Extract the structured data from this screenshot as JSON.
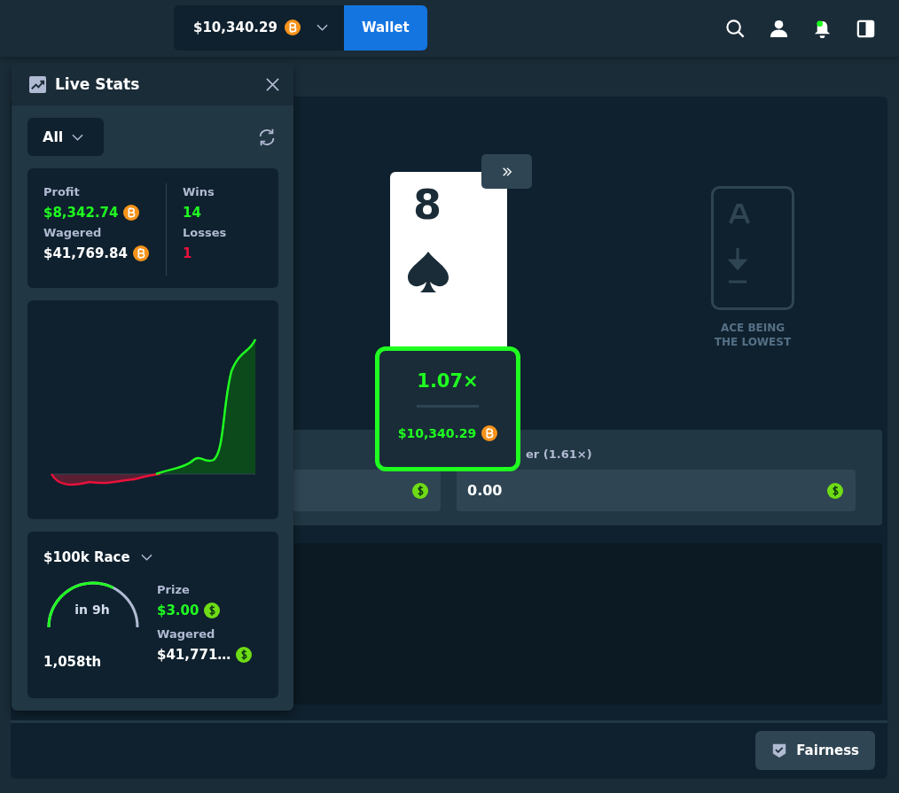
{
  "wallet": {
    "balance": "$10,340.29",
    "button": "Wallet"
  },
  "notifications": {
    "unread": true
  },
  "live_stats": {
    "title": "Live Stats",
    "filter": "All",
    "profit_label": "Profit",
    "profit": "$8,342.74",
    "wagered_label": "Wagered",
    "wagered": "$41,769.84",
    "wins_label": "Wins",
    "wins": "14",
    "losses_label": "Losses",
    "losses": "1"
  },
  "race": {
    "title": "$100k Race",
    "time": "in 9h",
    "level": 0.65,
    "rank": "1,058th",
    "prize_label": "Prize",
    "prize": "$3.00",
    "wagered_label": "Wagered",
    "wagered": "$41,771…"
  },
  "game": {
    "card": {
      "rank": "8"
    },
    "payout": {
      "multiplier": "1.07×",
      "amount": "$10,340.29"
    },
    "hint": "ACE BEING THE LOWEST",
    "bet_fields": [
      {
        "kind": "amount"
      },
      {
        "kind": "amount",
        "label": "er (1.61×)",
        "value": "0.00"
      }
    ]
  },
  "footer": {
    "fairness": "Fairness"
  }
}
